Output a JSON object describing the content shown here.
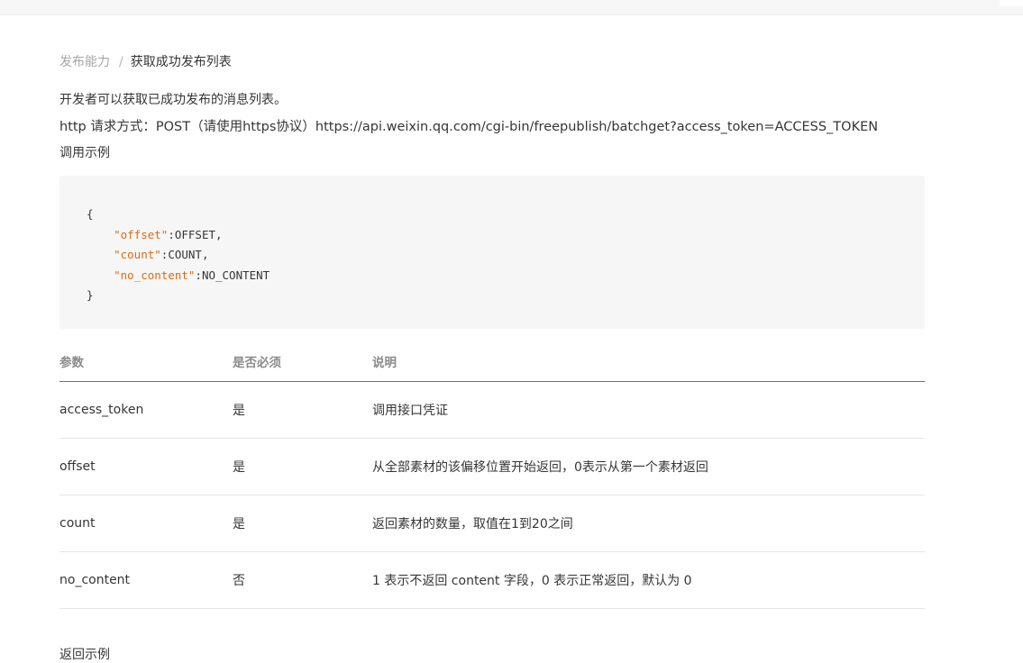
{
  "breadcrumb": {
    "parent": "发布能力",
    "separator": "/",
    "current": "获取成功发布列表"
  },
  "description": "开发者可以获取已成功发布的消息列表。",
  "http_request": "http 请求方式：POST（请使用https协议）https://api.weixin.qq.com/cgi-bin/freepublish/batchget?access_token=ACCESS_TOKEN",
  "example_heading": "调用示例",
  "code_example": {
    "open": "{",
    "lines": [
      {
        "key": "\"offset\"",
        "value": ":OFFSET,"
      },
      {
        "key": "\"count\"",
        "value": ":COUNT,"
      },
      {
        "key": "\"no_content\"",
        "value": ":NO_CONTENT"
      }
    ],
    "close": "}"
  },
  "params_table": {
    "headers": [
      "参数",
      "是否必须",
      "说明"
    ],
    "rows": [
      [
        "access_token",
        "是",
        "调用接口凭证"
      ],
      [
        "offset",
        "是",
        "从全部素材的该偏移位置开始返回，0表示从第一个素材返回"
      ],
      [
        "count",
        "是",
        "返回素材的数量，取值在1到20之间"
      ],
      [
        "no_content",
        "否",
        "1 表示不返回 content 字段，0 表示正常返回，默认为 0"
      ]
    ]
  },
  "return_heading": "返回示例",
  "colors": {
    "code_key": "#dd6b10",
    "code_background": "#f6f6f6",
    "breadcrumb_muted": "#a6a6a6",
    "text": "#353535"
  }
}
